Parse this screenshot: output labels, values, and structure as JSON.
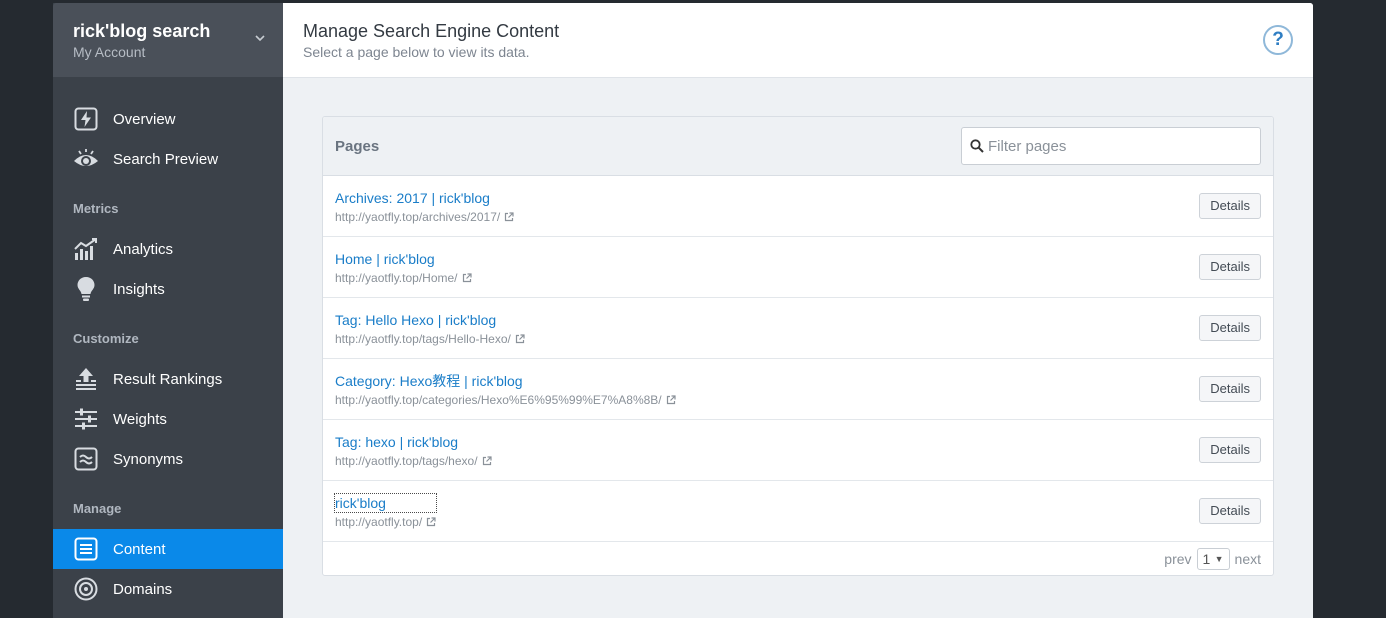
{
  "account": {
    "name": "rick'blog search",
    "sub": "My Account"
  },
  "nav": {
    "top": [
      {
        "label": "Overview",
        "icon": "bolt-icon"
      },
      {
        "label": "Search Preview",
        "icon": "eye-icon"
      }
    ],
    "sections": [
      {
        "label": "Metrics",
        "items": [
          {
            "label": "Analytics"
          },
          {
            "label": "Insights"
          }
        ]
      },
      {
        "label": "Customize",
        "items": [
          {
            "label": "Result Rankings"
          },
          {
            "label": "Weights"
          },
          {
            "label": "Synonyms"
          }
        ]
      },
      {
        "label": "Manage",
        "items": [
          {
            "label": "Content",
            "active": true
          },
          {
            "label": "Domains"
          }
        ]
      }
    ]
  },
  "header": {
    "title": "Manage Search Engine Content",
    "subtitle": "Select a page below to view its data.",
    "help": "?"
  },
  "panel": {
    "title": "Pages",
    "filter_placeholder": "Filter pages",
    "details_label": "Details",
    "rows": [
      {
        "title": "Archives: 2017 | rick'blog",
        "url": "http://yaotfly.top/archives/2017/"
      },
      {
        "title": "Home | rick'blog",
        "url": "http://yaotfly.top/Home/"
      },
      {
        "title": "Tag: Hello Hexo | rick'blog",
        "url": "http://yaotfly.top/tags/Hello-Hexo/"
      },
      {
        "title": "Category: Hexo教程 | rick'blog",
        "url": "http://yaotfly.top/categories/Hexo%E6%95%99%E7%A8%8B/"
      },
      {
        "title": "Tag: hexo | rick'blog",
        "url": "http://yaotfly.top/tags/hexo/"
      },
      {
        "title": "rick'blog",
        "url": "http://yaotfly.top/"
      }
    ]
  },
  "pager": {
    "prev": "prev",
    "page": "1",
    "next": "next"
  },
  "colors": {
    "active_nav": "#0a89e9",
    "link": "#1a7dc8",
    "sidebar": "#3b4149"
  }
}
